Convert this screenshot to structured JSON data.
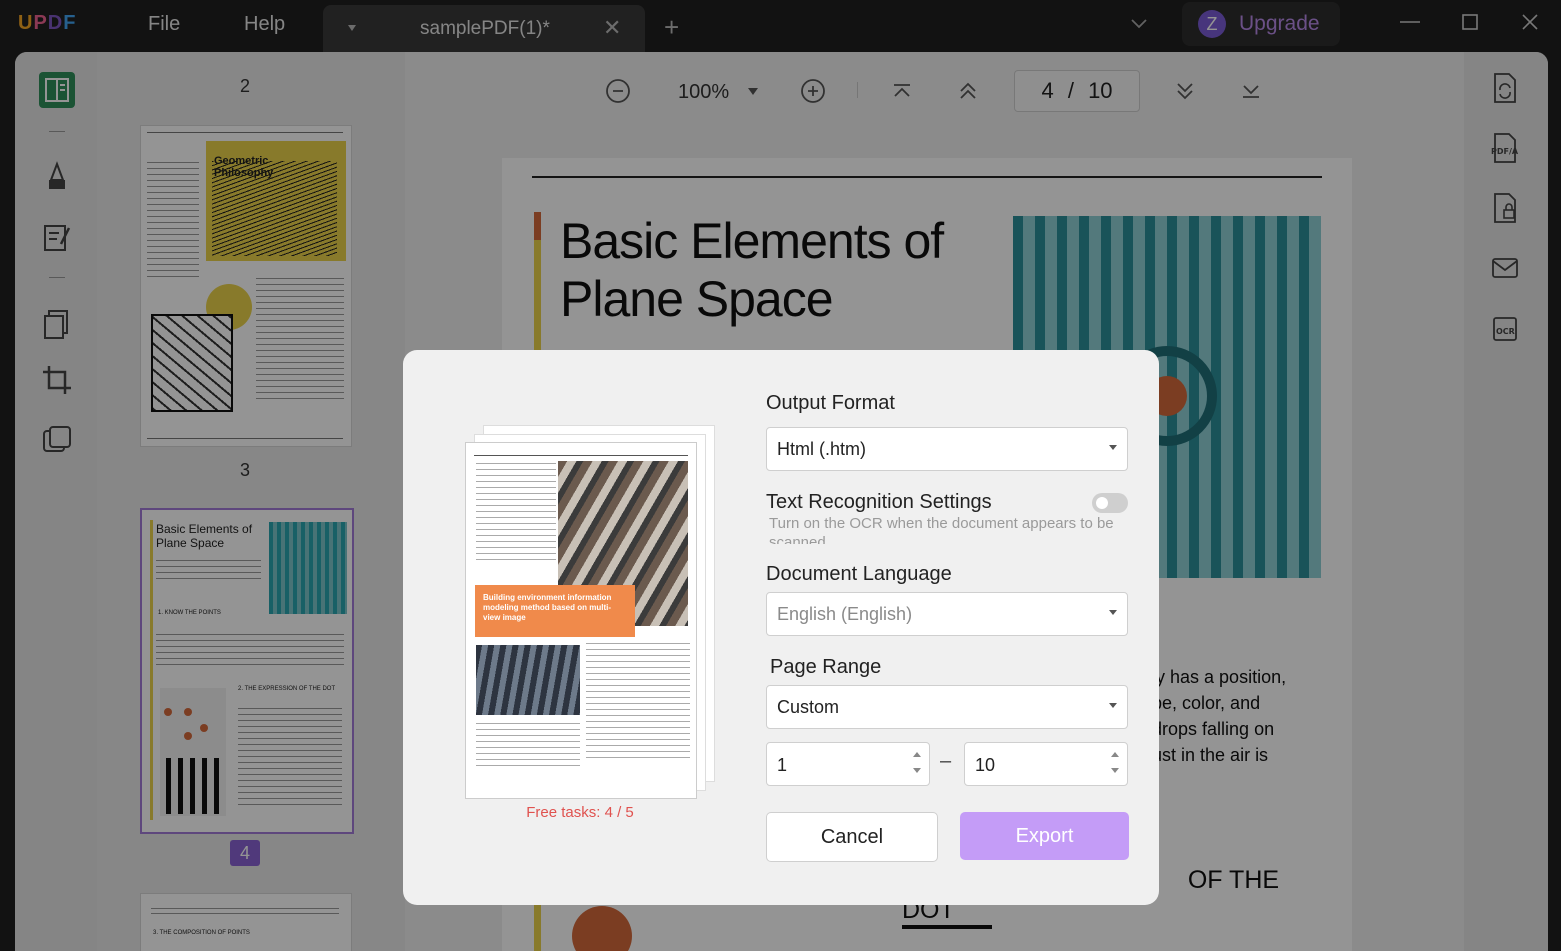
{
  "app": {
    "logo": "UPDF",
    "menu": [
      "File",
      "Help"
    ],
    "tab_title": "samplePDF(1)*",
    "upgrade_avatar": "Z",
    "upgrade_label": "Upgrade"
  },
  "viewer": {
    "zoom": "100%",
    "current_page": "4",
    "page_separator": "/",
    "total_pages": "10",
    "thumb_page_labels": [
      "2",
      "3",
      "4"
    ]
  },
  "thumbnails": {
    "page3_title": "Geometric Philosophy",
    "page4_title": "Basic Elements of Plane Space",
    "page4_heading1": "1. KNOW THE POINTS",
    "page4_heading2": "2. THE EXPRESSION OF THE DOT",
    "page5_heading": "3. THE COMPOSITION OF POINTS"
  },
  "document": {
    "title_line1": "Basic Elements of",
    "title_line2": "Plane Space",
    "body_lines": [
      "nly has a position,",
      "ape, color, and",
      "ndrops falling on",
      "dust in the air is"
    ],
    "heading_fragment": "N    OF THE",
    "heading_fragment2": "DOT"
  },
  "dialog": {
    "preview_callout": "Building environment information modeling method based on multi-view image",
    "free_tasks": "Free tasks: 4 / 5",
    "output_format_label": "Output Format",
    "output_format_value": "Html (.htm)",
    "ocr_label": "Text Recognition Settings",
    "ocr_hint": "Turn on the OCR when the document appears to be scanned",
    "language_label": "Document Language",
    "language_value": "English (English)",
    "page_range_label": "Page Range",
    "page_range_value": "Custom",
    "range_from": "1",
    "range_dash": "–",
    "range_to": "10",
    "cancel_label": "Cancel",
    "export_label": "Export"
  },
  "colors": {
    "accent_purple": "#8b63d5",
    "export_button": "#c49cf7",
    "free_tasks_red": "#e0524f",
    "doc_accent_orange": "#d5693b",
    "doc_accent_yellow": "#ead34a"
  }
}
